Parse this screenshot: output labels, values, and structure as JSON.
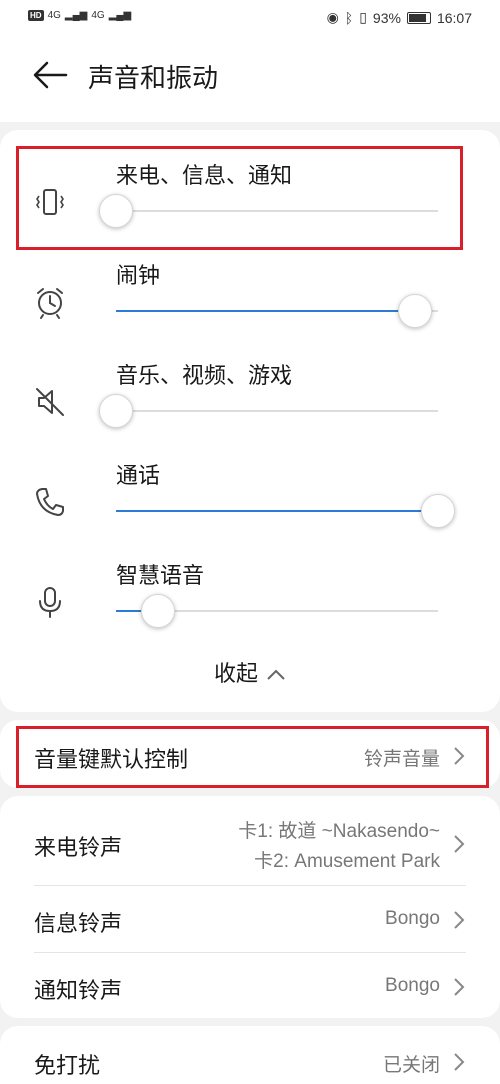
{
  "status_bar": {
    "net1": "4G",
    "net2": "4G",
    "battery": "93%",
    "time": "16:07"
  },
  "header": {
    "title": "声音和振动"
  },
  "volume": [
    {
      "label": "来电、信息、通知",
      "icon": "vibrate-icon",
      "level": 0.0
    },
    {
      "label": "闹钟",
      "icon": "alarm-clock-icon",
      "level": 0.93
    },
    {
      "label": "音乐、视频、游戏",
      "icon": "mute-speaker-icon",
      "level": 0.0
    },
    {
      "label": "通话",
      "icon": "phone-icon",
      "level": 1.0
    },
    {
      "label": "智慧语音",
      "icon": "microphone-icon",
      "level": 0.13
    }
  ],
  "collapse_label": "收起",
  "volume_key": {
    "label": "音量键默认控制",
    "value": "铃声音量"
  },
  "ringtones": [
    {
      "label": "来电铃声",
      "value_line1": "卡1: 故道 ~Nakasendo~",
      "value_line2": "卡2: Amusement Park"
    },
    {
      "label": "信息铃声",
      "value": "Bongo"
    },
    {
      "label": "通知铃声",
      "value": "Bongo"
    }
  ],
  "dnd": {
    "label": "免打扰",
    "value": "已关闭"
  },
  "colors": {
    "accent": "#2c7bd6",
    "highlight": "#d9202a"
  }
}
